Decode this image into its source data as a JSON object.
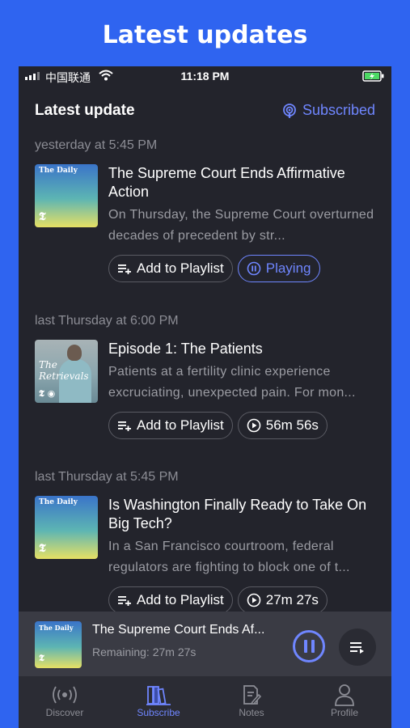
{
  "banner": {
    "title": "Latest updates"
  },
  "status_bar": {
    "carrier": "中国联通",
    "time": "11:18 PM"
  },
  "header": {
    "title": "Latest update",
    "subscribed_label": "Subscribed"
  },
  "episodes": [
    {
      "date": "yesterday at 5:45 PM",
      "cover": "the-daily",
      "cover_text": "The Daily",
      "title": "The Supreme Court Ends Affirmative Action",
      "description": "On Thursday, the Supreme Court overturned decades of precedent by str...",
      "add_label": "Add to Playlist",
      "status_label": "Playing",
      "status_icon": "pause-circle-icon"
    },
    {
      "date": "last Thursday at 6:00 PM",
      "cover": "the-retrievals",
      "cover_text": "The Retrievals",
      "title": "Episode 1: The Patients",
      "description": "Patients at a fertility clinic experience excruciating, unexpected pain. For mon...",
      "add_label": "Add to Playlist",
      "status_label": "56m 56s",
      "status_icon": "play-circle-icon"
    },
    {
      "date": "last Thursday at 5:45 PM",
      "cover": "the-daily",
      "cover_text": "The Daily",
      "title": "Is Washington Finally Ready to Take On Big Tech?",
      "description": "In a San Francisco courtroom, federal regulators are fighting to block one of t...",
      "add_label": "Add to Playlist",
      "status_label": "27m 27s",
      "status_icon": "play-circle-icon"
    }
  ],
  "mini_player": {
    "title": "The Supreme Court Ends Af...",
    "remaining": "Remaining: 27m 27s",
    "cover_text": "The Daily"
  },
  "tabs": [
    {
      "label": "Discover",
      "icon": "broadcast-icon",
      "active": false
    },
    {
      "label": "Subscribe",
      "icon": "library-icon",
      "active": true
    },
    {
      "label": "Notes",
      "icon": "notes-icon",
      "active": false
    },
    {
      "label": "Profile",
      "icon": "person-icon",
      "active": false
    }
  ],
  "colors": {
    "accent": "#6f86ff",
    "background": "#23242c",
    "banner": "#2f64f0"
  }
}
